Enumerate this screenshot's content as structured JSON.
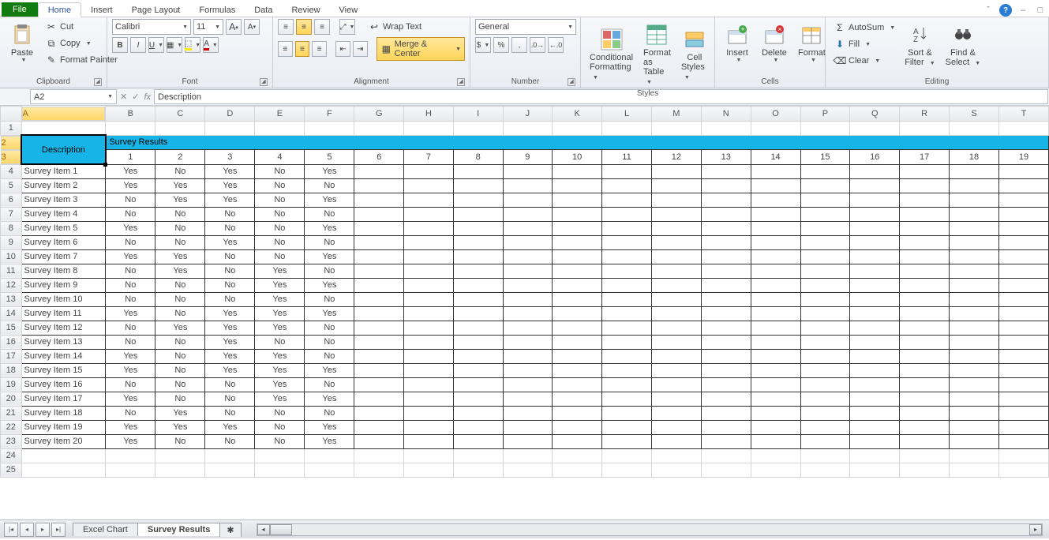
{
  "menu": {
    "file": "File",
    "tabs": [
      "Home",
      "Insert",
      "Page Layout",
      "Formulas",
      "Data",
      "Review",
      "View"
    ],
    "active": 0
  },
  "titlebar_controls": {
    "caret": "ˇ",
    "help": "?",
    "min": "–",
    "box": "□"
  },
  "ribbon": {
    "clipboard": {
      "label": "Clipboard",
      "paste": "Paste",
      "cut": "Cut",
      "copy": "Copy",
      "painter": "Format Painter"
    },
    "font": {
      "label": "Font",
      "name": "Calibri",
      "size": "11"
    },
    "alignment": {
      "label": "Alignment",
      "wrap": "Wrap Text",
      "merge": "Merge & Center"
    },
    "number": {
      "label": "Number",
      "format": "General"
    },
    "styles": {
      "label": "Styles",
      "cond": "Conditional",
      "cond2": "Formatting",
      "fmt": "Format",
      "fmt2": "as Table",
      "cell": "Cell",
      "cell2": "Styles"
    },
    "cells": {
      "label": "Cells",
      "insert": "Insert",
      "delete": "Delete",
      "format": "Format"
    },
    "editing": {
      "label": "Editing",
      "autosum": "AutoSum",
      "fill": "Fill",
      "clear": "Clear",
      "sort": "Sort &",
      "sort2": "Filter",
      "find": "Find &",
      "find2": "Select"
    }
  },
  "formula_bar": {
    "name": "A2",
    "fx": "fx",
    "value": "Description"
  },
  "columns": [
    "A",
    "B",
    "C",
    "D",
    "E",
    "F",
    "G",
    "H",
    "I",
    "J",
    "K",
    "L",
    "M",
    "N",
    "O",
    "P",
    "Q",
    "R",
    "S",
    "T"
  ],
  "row_numbers": [
    1,
    2,
    3,
    4,
    5,
    6,
    7,
    8,
    9,
    10,
    11,
    12,
    13,
    14,
    15,
    16,
    17,
    18,
    19,
    20,
    21,
    22,
    23,
    24,
    25
  ],
  "sheet": {
    "description_header": "Description",
    "survey_header": "Survey Results",
    "col_numbers": [
      1,
      2,
      3,
      4,
      5,
      6,
      7,
      8,
      9,
      10,
      11,
      12,
      13,
      14,
      15,
      16,
      17,
      18,
      19
    ],
    "rows": [
      {
        "label": "Survey Item 1",
        "v": [
          "Yes",
          "No",
          "Yes",
          "No",
          "Yes"
        ]
      },
      {
        "label": "Survey Item 2",
        "v": [
          "Yes",
          "Yes",
          "Yes",
          "No",
          "No"
        ]
      },
      {
        "label": "Survey Item 3",
        "v": [
          "No",
          "Yes",
          "Yes",
          "No",
          "Yes"
        ]
      },
      {
        "label": "Survey Item 4",
        "v": [
          "No",
          "No",
          "No",
          "No",
          "No"
        ]
      },
      {
        "label": "Survey Item 5",
        "v": [
          "Yes",
          "No",
          "No",
          "No",
          "Yes"
        ]
      },
      {
        "label": "Survey Item 6",
        "v": [
          "No",
          "No",
          "Yes",
          "No",
          "No"
        ]
      },
      {
        "label": "Survey Item 7",
        "v": [
          "Yes",
          "Yes",
          "No",
          "No",
          "Yes"
        ]
      },
      {
        "label": "Survey Item 8",
        "v": [
          "No",
          "Yes",
          "No",
          "Yes",
          "No"
        ]
      },
      {
        "label": "Survey Item 9",
        "v": [
          "No",
          "No",
          "No",
          "Yes",
          "Yes"
        ]
      },
      {
        "label": "Survey Item 10",
        "v": [
          "No",
          "No",
          "No",
          "Yes",
          "No"
        ]
      },
      {
        "label": "Survey Item 11",
        "v": [
          "Yes",
          "No",
          "Yes",
          "Yes",
          "Yes"
        ]
      },
      {
        "label": "Survey Item 12",
        "v": [
          "No",
          "Yes",
          "Yes",
          "Yes",
          "No"
        ]
      },
      {
        "label": "Survey Item 13",
        "v": [
          "No",
          "No",
          "Yes",
          "No",
          "No"
        ]
      },
      {
        "label": "Survey Item 14",
        "v": [
          "Yes",
          "No",
          "Yes",
          "Yes",
          "No"
        ]
      },
      {
        "label": "Survey Item 15",
        "v": [
          "Yes",
          "No",
          "Yes",
          "Yes",
          "Yes"
        ]
      },
      {
        "label": "Survey Item 16",
        "v": [
          "No",
          "No",
          "No",
          "Yes",
          "No"
        ]
      },
      {
        "label": "Survey Item 17",
        "v": [
          "Yes",
          "No",
          "No",
          "Yes",
          "Yes"
        ]
      },
      {
        "label": "Survey Item 18",
        "v": [
          "No",
          "Yes",
          "No",
          "No",
          "No"
        ]
      },
      {
        "label": "Survey Item 19",
        "v": [
          "Yes",
          "Yes",
          "Yes",
          "No",
          "Yes"
        ]
      },
      {
        "label": "Survey Item 20",
        "v": [
          "Yes",
          "No",
          "No",
          "No",
          "Yes"
        ]
      }
    ]
  },
  "sheet_tabs": {
    "tabs": [
      "Excel Chart",
      "Survey Results"
    ],
    "active": 1,
    "new": "✱"
  }
}
